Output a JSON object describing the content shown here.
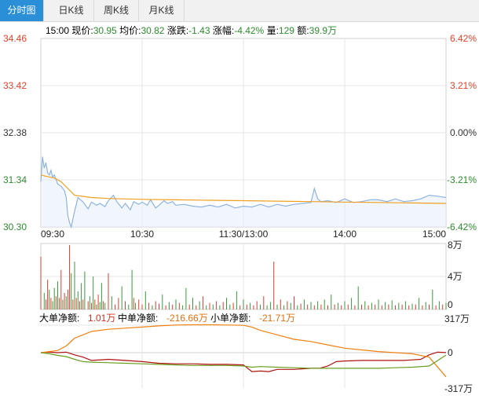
{
  "tabs": [
    {
      "label": "分时图",
      "active": true
    },
    {
      "label": "日K线",
      "active": false
    },
    {
      "label": "周K线",
      "active": false
    },
    {
      "label": "月K线",
      "active": false
    }
  ],
  "quote": {
    "time": "15:00",
    "price_label": "现价:",
    "price": "30.95",
    "avg_label": "均价:",
    "avg": "30.82",
    "change_label": "涨跌:",
    "change": "-1.43",
    "pct_label": "涨幅:",
    "pct": "-4.42%",
    "vol_label": "量:",
    "vol": "129",
    "amt_label": "额:",
    "amt": "39.9万"
  },
  "colors": {
    "up": "#e8402a",
    "down": "#2e8b2e",
    "flat": "#333333",
    "price_line": "#8fb3e0",
    "avg_line": "#f0a020",
    "grid": "#e4e4e4",
    "vol_bar_up": "#d84030",
    "vol_bar_down": "#3a9a3a"
  },
  "chart_data": [
    {
      "type": "line",
      "panel": "price",
      "y_left_ticks": [
        "34.46",
        "33.42",
        "32.38",
        "31.34",
        "30.30"
      ],
      "y_right_ticks": [
        "6.42%",
        "3.21%",
        "0.00%",
        "-3.21%",
        "-6.42%"
      ],
      "ylim": [
        30.3,
        34.46
      ],
      "prev_close": 32.38,
      "x_ticks": [
        "09:30",
        "10:30",
        "11:30/13:00",
        "14:00",
        "15:00"
      ],
      "x_range": [
        0,
        240
      ],
      "series": [
        {
          "key": "price",
          "x": [
            0,
            1,
            2,
            3,
            4,
            5,
            6,
            7,
            8,
            9,
            10,
            12,
            14,
            15,
            16,
            17,
            18,
            20,
            22,
            25,
            28,
            30,
            33,
            35,
            38,
            40,
            43,
            45,
            48,
            50,
            53,
            55,
            58,
            60,
            63,
            65,
            68,
            70,
            73,
            75,
            78,
            80,
            85,
            90,
            95,
            100,
            105,
            110,
            115,
            120,
            125,
            130,
            135,
            140,
            145,
            150,
            155,
            160,
            162,
            164,
            166,
            170,
            175,
            180,
            185,
            190,
            195,
            200,
            205,
            210,
            215,
            220,
            225,
            230,
            235,
            240
          ],
          "y": [
            31.3,
            31.85,
            31.6,
            31.72,
            31.5,
            31.45,
            31.55,
            31.4,
            31.45,
            31.35,
            31.25,
            31.2,
            31.1,
            30.95,
            30.55,
            30.4,
            30.3,
            30.65,
            30.95,
            30.85,
            30.7,
            30.85,
            30.78,
            30.82,
            30.75,
            30.88,
            31.0,
            30.86,
            30.72,
            30.82,
            30.68,
            30.86,
            30.8,
            30.85,
            30.78,
            30.9,
            30.72,
            30.78,
            30.88,
            30.82,
            30.86,
            30.78,
            30.8,
            30.76,
            30.74,
            30.78,
            30.74,
            30.8,
            30.72,
            30.76,
            30.74,
            30.8,
            30.74,
            30.8,
            30.76,
            30.8,
            30.82,
            30.84,
            31.15,
            30.92,
            30.86,
            30.88,
            30.84,
            30.92,
            30.84,
            30.86,
            30.9,
            30.9,
            30.86,
            30.92,
            30.86,
            30.88,
            30.92,
            31.0,
            30.98,
            30.95
          ]
        },
        {
          "key": "avg",
          "x": [
            0,
            3,
            8,
            12,
            16,
            20,
            30,
            40,
            60,
            80,
            100,
            120,
            140,
            160,
            180,
            200,
            220,
            240
          ],
          "y": [
            31.45,
            31.42,
            31.38,
            31.3,
            31.15,
            31.0,
            30.95,
            30.93,
            30.91,
            30.9,
            30.89,
            30.88,
            30.87,
            30.86,
            30.85,
            30.84,
            30.83,
            30.82
          ]
        }
      ]
    },
    {
      "type": "bar",
      "panel": "volume",
      "y_right_ticks": [
        "8万",
        "4万",
        "0"
      ],
      "ylim": [
        0,
        8
      ],
      "x_range": [
        0,
        240
      ],
      "x": [
        0,
        2,
        3,
        4,
        5,
        6,
        7,
        8,
        9,
        10,
        11,
        12,
        13,
        14,
        15,
        16,
        17,
        18,
        19,
        20,
        21,
        22,
        23,
        24,
        25,
        26,
        28,
        29,
        30,
        31,
        32,
        33,
        34,
        35,
        36,
        37,
        38,
        40,
        42,
        44,
        46,
        48,
        50,
        52,
        54,
        55,
        56,
        58,
        60,
        62,
        64,
        66,
        68,
        70,
        72,
        74,
        76,
        78,
        80,
        82,
        84,
        86,
        88,
        90,
        92,
        94,
        96,
        98,
        100,
        102,
        104,
        106,
        108,
        110,
        112,
        114,
        116,
        118,
        120,
        122,
        124,
        126,
        128,
        130,
        132,
        134,
        136,
        138,
        140,
        142,
        144,
        146,
        148,
        150,
        152,
        154,
        156,
        158,
        160,
        162,
        164,
        166,
        168,
        170,
        172,
        174,
        176,
        178,
        180,
        182,
        184,
        186,
        188,
        190,
        192,
        194,
        196,
        198,
        200,
        202,
        204,
        206,
        208,
        210,
        212,
        214,
        216,
        218,
        220,
        222,
        224,
        226,
        228,
        230,
        232,
        234,
        236,
        238,
        240
      ],
      "values": [
        6.4,
        2.0,
        1.2,
        3.6,
        2.4,
        1.4,
        1.0,
        2.6,
        1.6,
        3.4,
        1.4,
        4.8,
        1.2,
        2.0,
        1.6,
        2.4,
        7.8,
        4.4,
        1.2,
        5.8,
        1.4,
        2.2,
        1.0,
        3.2,
        1.2,
        4.6,
        1.0,
        1.6,
        0.8,
        4.0,
        1.2,
        0.6,
        1.8,
        0.9,
        3.2,
        1.0,
        0.8,
        4.4,
        1.6,
        0.6,
        1.4,
        2.8,
        1.0,
        0.6,
        4.8,
        1.4,
        0.8,
        1.2,
        0.6,
        2.2,
        0.8,
        0.5,
        1.0,
        0.7,
        1.8,
        0.5,
        0.9,
        0.6,
        1.2,
        0.8,
        0.5,
        2.6,
        0.6,
        1.4,
        0.5,
        1.0,
        1.6,
        0.5,
        0.8,
        0.6,
        1.0,
        0.5,
        0.9,
        1.4,
        0.6,
        0.8,
        2.2,
        0.5,
        1.2,
        0.6,
        0.8,
        0.5,
        1.0,
        0.6,
        1.6,
        0.5,
        0.9,
        5.8,
        0.6,
        1.2,
        0.5,
        1.0,
        0.8,
        1.6,
        0.5,
        0.7,
        1.2,
        0.6,
        0.9,
        0.5,
        1.0,
        0.6,
        1.2,
        0.5,
        1.8,
        0.6,
        0.8,
        0.5,
        1.0,
        0.6,
        1.4,
        0.5,
        2.8,
        0.6,
        1.0,
        0.5,
        0.8,
        0.6,
        1.2,
        0.5,
        0.9,
        0.6,
        1.1,
        0.5,
        0.8,
        0.6,
        1.0,
        0.5,
        0.7,
        0.6,
        1.4,
        0.5,
        0.9,
        0.6,
        2.4,
        0.5,
        1.0,
        0.6,
        0.8,
        0.5,
        2.6
      ],
      "colors_up_down": [
        "u",
        "d",
        "u",
        "u",
        "d",
        "u",
        "d",
        "d",
        "u",
        "d",
        "u",
        "u",
        "d",
        "u",
        "d",
        "u",
        "u",
        "d",
        "u",
        "d",
        "u",
        "d",
        "u",
        "d",
        "u",
        "d",
        "u",
        "d",
        "u",
        "d",
        "u",
        "d",
        "u",
        "d",
        "d",
        "u",
        "d",
        "u",
        "d",
        "u",
        "u",
        "d",
        "u",
        "d",
        "d",
        "u",
        "d",
        "u",
        "u",
        "d",
        "u",
        "d",
        "u",
        "u",
        "d",
        "u",
        "d",
        "u",
        "d",
        "u",
        "d",
        "d",
        "u",
        "d",
        "u",
        "d",
        "u",
        "d",
        "u",
        "d",
        "u",
        "d",
        "u",
        "d",
        "d",
        "u",
        "d",
        "u",
        "d",
        "u",
        "d",
        "u",
        "u",
        "d",
        "u",
        "d",
        "d",
        "u",
        "d",
        "u",
        "d",
        "u",
        "d",
        "u",
        "d",
        "u",
        "d",
        "u",
        "d",
        "u",
        "d",
        "u",
        "d",
        "u",
        "d",
        "u",
        "d",
        "u",
        "d",
        "u",
        "d",
        "u",
        "d",
        "u",
        "d",
        "u",
        "d",
        "u",
        "d",
        "u",
        "d",
        "u",
        "d",
        "u",
        "d",
        "u",
        "d",
        "u",
        "d",
        "u",
        "d",
        "u",
        "d",
        "u",
        "d",
        "u",
        "d",
        "u",
        "d"
      ]
    },
    {
      "type": "line",
      "panel": "moneyflow",
      "labels": {
        "big_label": "大单净额:",
        "big": "1.01万",
        "mid_label": "中单净额:",
        "mid": "-216.66万",
        "small_label": "小单净额:",
        "small": "-21.71万"
      },
      "y_right_ticks": [
        "317万",
        "0",
        "-317万"
      ],
      "ylim": [
        -317,
        317
      ],
      "x_range": [
        0,
        240
      ],
      "series": [
        {
          "key": "big",
          "color": "#b01010",
          "x": [
            0,
            5,
            10,
            15,
            20,
            25,
            30,
            40,
            50,
            60,
            70,
            80,
            90,
            100,
            110,
            120,
            125,
            130,
            135,
            140,
            150,
            160,
            165,
            170,
            175,
            180,
            190,
            200,
            210,
            215,
            220,
            225,
            230,
            235,
            240
          ],
          "y": [
            0,
            5,
            0,
            5,
            -20,
            -40,
            -70,
            -60,
            -70,
            -80,
            -95,
            -100,
            -100,
            -105,
            -105,
            -110,
            -170,
            -165,
            -170,
            -150,
            -150,
            -140,
            -140,
            -120,
            -80,
            -75,
            -70,
            -70,
            -70,
            -70,
            -65,
            -60,
            -20,
            5,
            1
          ]
        },
        {
          "key": "mid",
          "color": "#f08010",
          "x": [
            0,
            5,
            10,
            15,
            20,
            25,
            30,
            40,
            50,
            60,
            70,
            80,
            90,
            100,
            110,
            120,
            125,
            130,
            140,
            150,
            160,
            170,
            180,
            190,
            200,
            210,
            220,
            230,
            240
          ],
          "y": [
            0,
            10,
            20,
            60,
            130,
            160,
            190,
            210,
            220,
            230,
            240,
            248,
            250,
            250,
            248,
            245,
            230,
            200,
            160,
            120,
            100,
            70,
            40,
            25,
            10,
            0,
            -10,
            -40,
            -217
          ]
        },
        {
          "key": "small",
          "color": "#6a9e20",
          "x": [
            0,
            5,
            10,
            15,
            20,
            25,
            30,
            40,
            50,
            60,
            70,
            80,
            90,
            100,
            110,
            120,
            125,
            130,
            140,
            150,
            160,
            170,
            180,
            190,
            200,
            210,
            220,
            230,
            240
          ],
          "y": [
            0,
            -10,
            -25,
            -35,
            -60,
            -80,
            -85,
            -90,
            -95,
            -100,
            -105,
            -110,
            -115,
            -115,
            -115,
            -120,
            -130,
            -125,
            -130,
            -135,
            -140,
            -140,
            -140,
            -140,
            -140,
            -135,
            -130,
            -120,
            -22
          ]
        }
      ]
    }
  ]
}
